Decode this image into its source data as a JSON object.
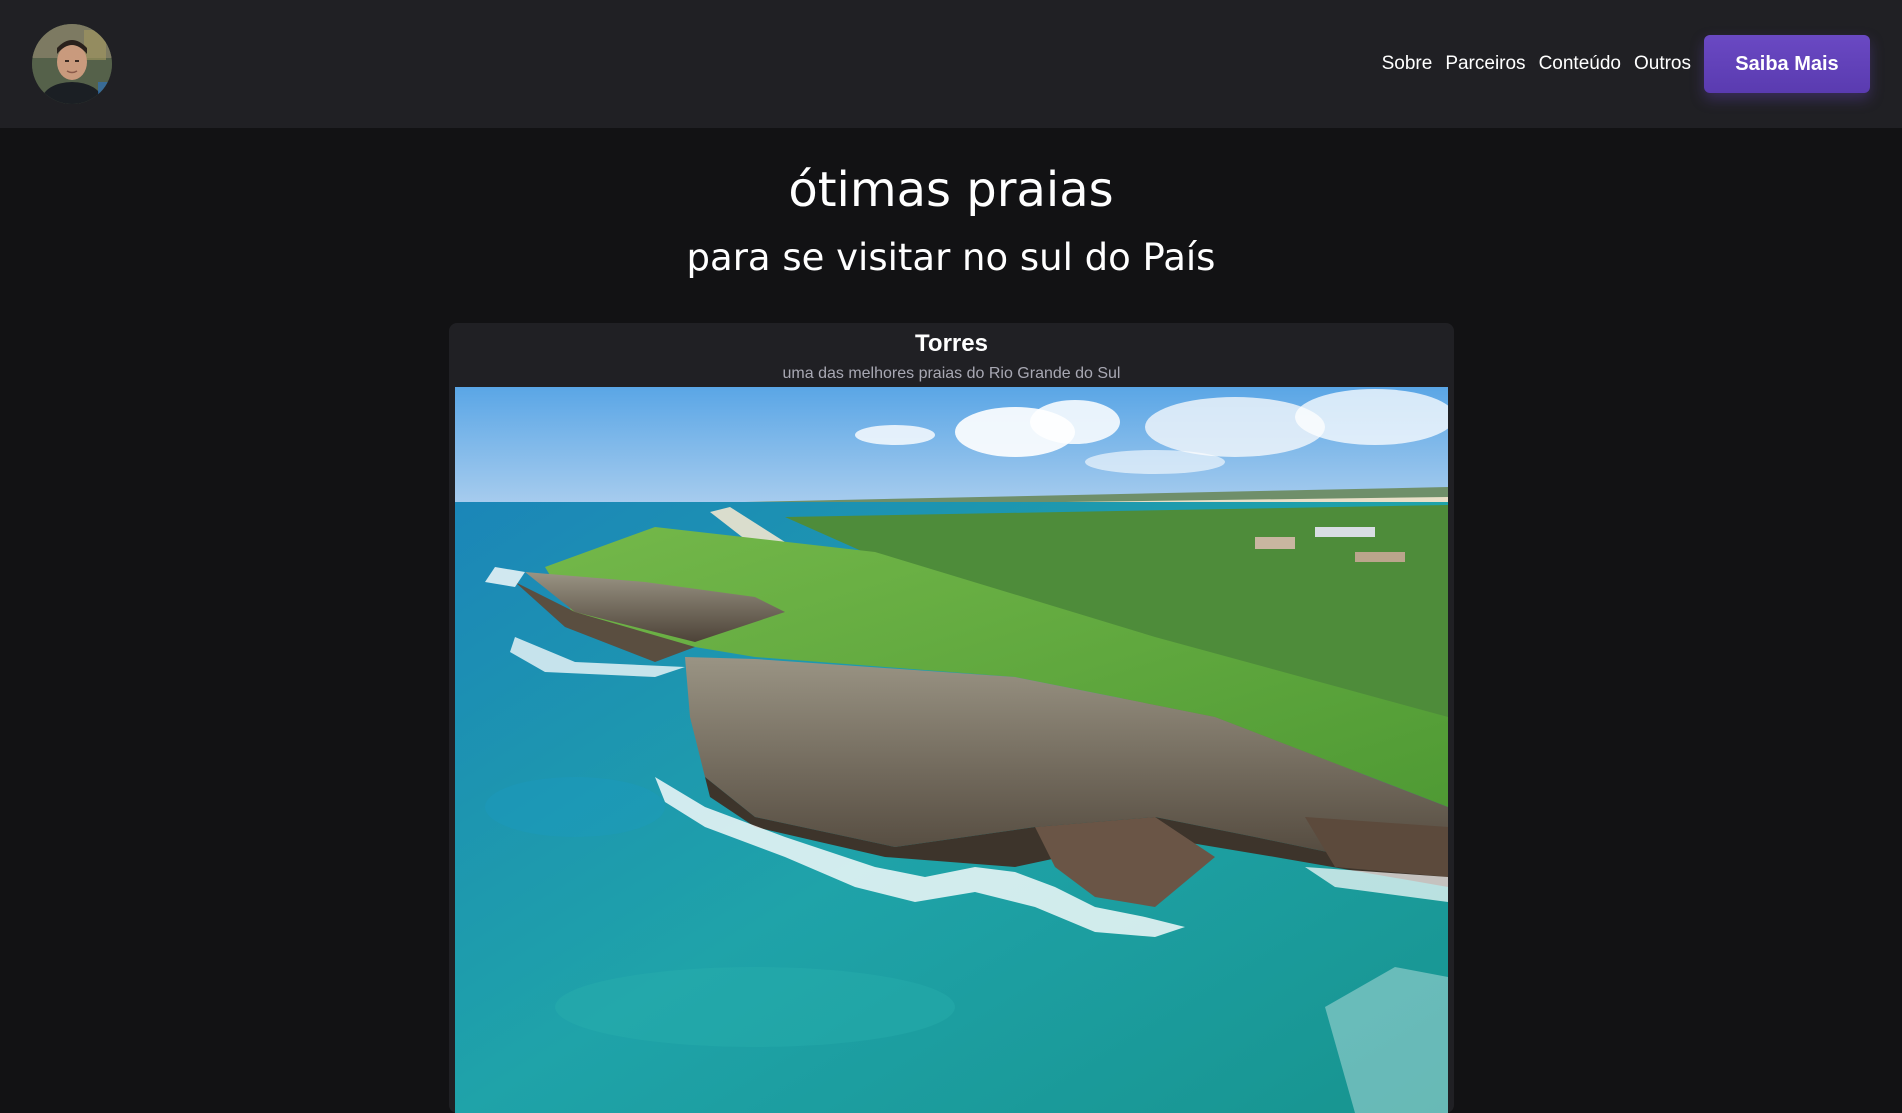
{
  "header": {
    "avatar_alt": "profile-avatar",
    "nav": [
      "Sobre",
      "Parceiros",
      "Conteúdo",
      "Outros"
    ],
    "cta_label": "Saiba Mais"
  },
  "hero": {
    "title": "ótimas praias",
    "subtitle": "para se visitar no sul do País"
  },
  "card": {
    "title": "Torres",
    "subtitle": "uma das melhores praias do Rio Grande do Sul"
  },
  "colors": {
    "page_bg": "#121214",
    "header_bg": "#202024",
    "accent": "#6a49c3",
    "muted_text": "#a8a8b3"
  }
}
